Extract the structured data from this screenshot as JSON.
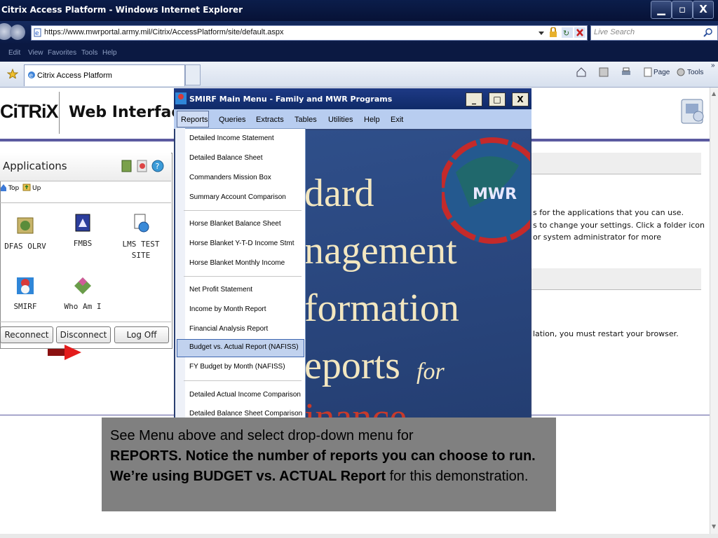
{
  "browser": {
    "window_title": "Citrix Access Platform - Windows Internet Explorer",
    "url": "https://www.mwrportal.army.mil/Citrix/AccessPlatform/site/default.aspx",
    "search_placeholder": "Live Search",
    "menu": [
      "Edit",
      "View",
      "Favorites",
      "Tools",
      "Help"
    ],
    "tab_label": "Citrix Access Platform",
    "toolbar": {
      "page_label": "Page",
      "tools_label": "Tools",
      "more": "»"
    }
  },
  "citrix": {
    "logo_text": "CiTRiX",
    "title": "Web Interface",
    "applications_title": "Applications",
    "nav_top": "Top",
    "nav_up": "Up",
    "apps": [
      {
        "label": "DFAS OLRV",
        "icon": "dfas-icon"
      },
      {
        "label": "FMBS",
        "icon": "fmbs-icon"
      },
      {
        "label": "LMS TEST SITE",
        "icon": "lms-icon"
      },
      {
        "label": "SMIRF",
        "icon": "smirf-icon"
      },
      {
        "label": "Who Am I",
        "icon": "whoami-icon"
      }
    ],
    "buttons": {
      "reconnect": "Reconnect",
      "disconnect": "Disconnect",
      "logoff": "Log Off"
    },
    "right_text": [
      "s for the applications that you can use.",
      "s to change your settings. Click a folder icon",
      " or system administrator for more",
      "lation, you must restart your browser."
    ]
  },
  "smirf": {
    "title": "SMIRF Main Menu - Family and MWR Programs",
    "window_buttons": {
      "minimize": "_",
      "maximize": "□",
      "close": "X"
    },
    "menu": [
      "Reports",
      "Queries",
      "Extracts",
      "Tables",
      "Utilities",
      "Help",
      "Exit"
    ],
    "reports_items": [
      "Detailed Income Statement",
      "Detailed Balance Sheet",
      "Commanders Mission Box",
      "Summary Account Comparison",
      "Horse Blanket Balance Sheet",
      "Horse Blanket Y-T-D Income Stmt",
      "Horse Blanket Monthly Income",
      "Net Profit Statement",
      "Income by Month Report",
      "Financial Analysis Report",
      "Budget vs. Actual Report (NAFISS)",
      "FY Budget by Month (NAFISS)",
      "Detailed Actual Income Comparison",
      "Detailed Balance Sheet Comparison"
    ],
    "highlighted_item": "Budget vs. Actual Report (NAFISS)",
    "banner_lines": [
      "dard",
      "nagement",
      "formation",
      "eports",
      "for",
      "inance"
    ],
    "banner_logo": "MWR"
  },
  "callout": {
    "line1": "See Menu above and select drop-down menu for",
    "bold": "REPORTS.  Notice the number of reports you can choose to run.  We’re using BUDGET vs. ACTUAL Report",
    "tail": "  for this demonstration."
  }
}
